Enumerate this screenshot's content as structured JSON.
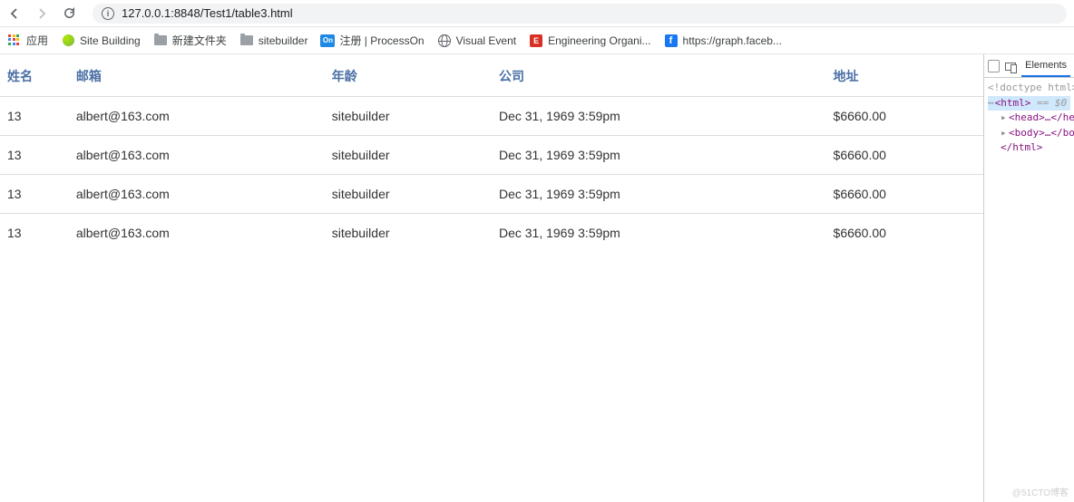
{
  "browser": {
    "url_display": "127.0.0.1:8848/Test1/table3.html",
    "url_host": "127.0.0.1"
  },
  "bookmarks": {
    "apps": "应用",
    "items": [
      {
        "label": "Site Building",
        "icon": "green"
      },
      {
        "label": "新建文件夹",
        "icon": "folder"
      },
      {
        "label": "sitebuilder",
        "icon": "folder"
      },
      {
        "label": "注册 | ProcessOn",
        "icon": "on"
      },
      {
        "label": "Visual Event",
        "icon": "globe"
      },
      {
        "label": "Engineering Organi...",
        "icon": "red"
      },
      {
        "label": "https://graph.faceb...",
        "icon": "fb"
      }
    ]
  },
  "table": {
    "headers": [
      "姓名",
      "邮箱",
      "年龄",
      "公司",
      "地址"
    ],
    "rows": [
      {
        "c0": "13",
        "c1": "albert@163.com",
        "c2": "sitebuilder",
        "c3": "Dec 31, 1969 3:59pm",
        "c4": "$6660.00"
      },
      {
        "c0": "13",
        "c1": "albert@163.com",
        "c2": "sitebuilder",
        "c3": "Dec 31, 1969 3:59pm",
        "c4": "$6660.00"
      },
      {
        "c0": "13",
        "c1": "albert@163.com",
        "c2": "sitebuilder",
        "c3": "Dec 31, 1969 3:59pm",
        "c4": "$6660.00"
      },
      {
        "c0": "13",
        "c1": "albert@163.com",
        "c2": "sitebuilder",
        "c3": "Dec 31, 1969 3:59pm",
        "c4": "$6660.00"
      }
    ]
  },
  "devtools": {
    "tab": "Elements",
    "doctype": "<!doctype html>",
    "html_open": "<html>",
    "eq": " == $0",
    "head": "<head>…</head>",
    "body": "<body>…</body>",
    "html_close": "</html>"
  },
  "watermark": "@51CTO博客"
}
